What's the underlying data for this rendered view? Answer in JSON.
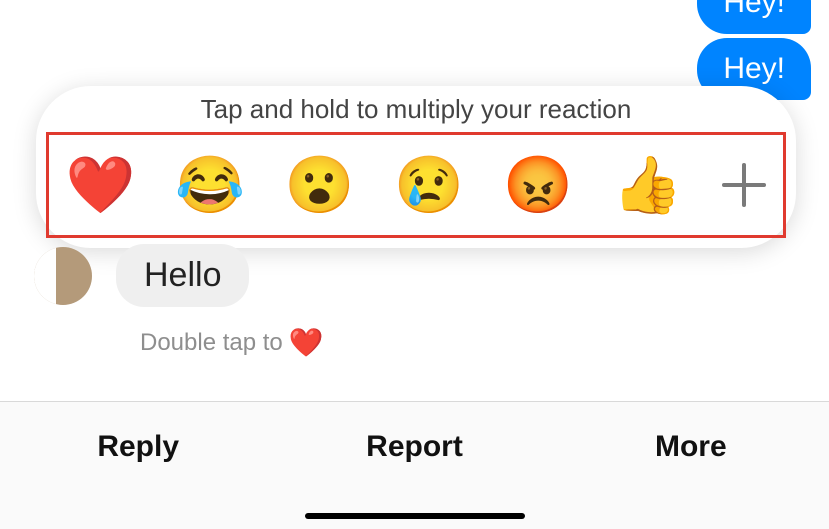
{
  "messages": {
    "out1": "Hey!",
    "out2": "Hey!",
    "in1": "Hello"
  },
  "reaction_popup": {
    "hint": "Tap and hold to multiply your reaction",
    "options": {
      "heart": "❤️",
      "laugh": "😂",
      "wow": "😮",
      "cry": "😢",
      "angry": "😡",
      "like": "👍"
    }
  },
  "below_hint": {
    "text": "Double tap to",
    "heart": "❤️"
  },
  "actions": {
    "reply": "Reply",
    "report": "Report",
    "more": "More"
  }
}
